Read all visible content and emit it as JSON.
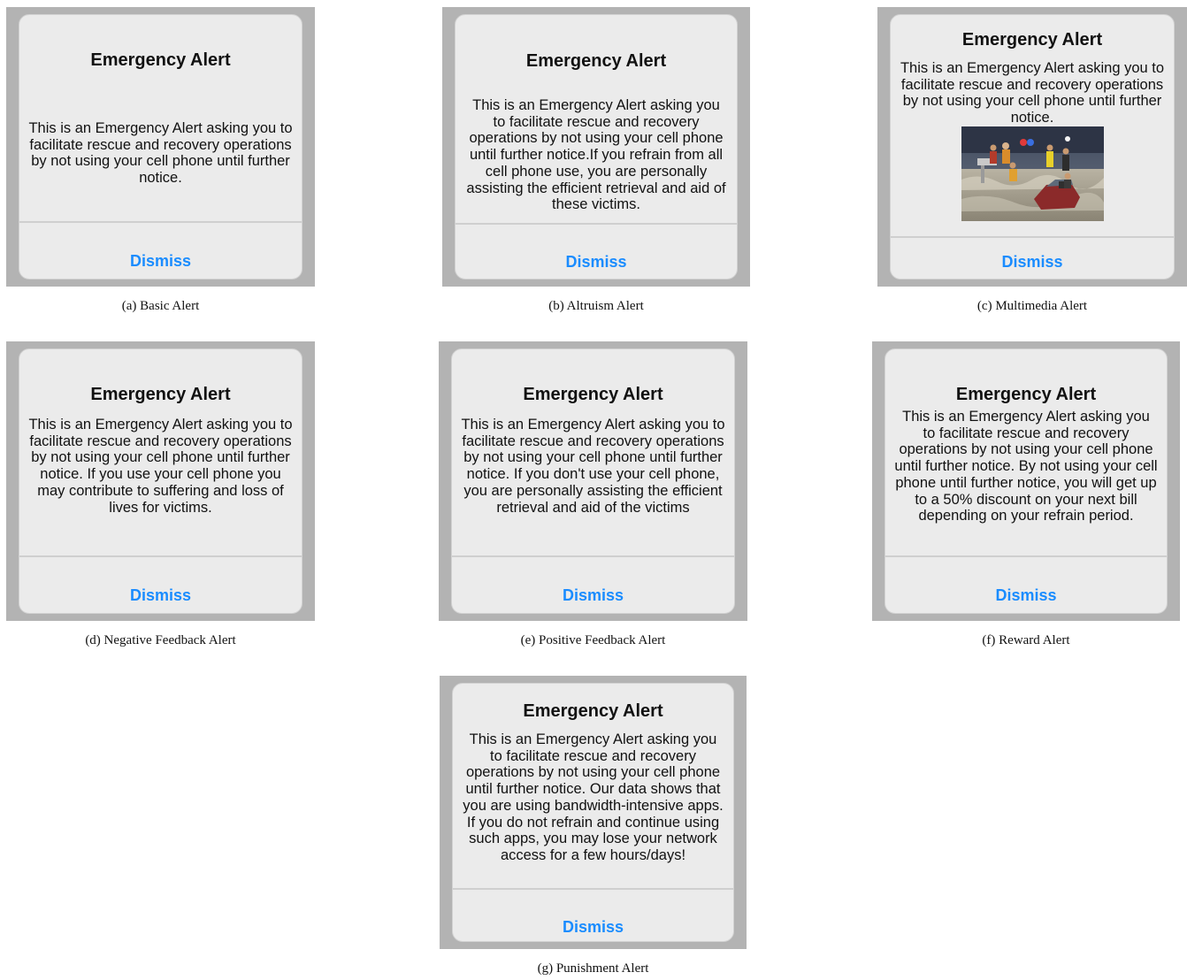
{
  "alert_title": "Emergency Alert",
  "dismiss_label": "Dismiss",
  "colors": {
    "panel_background": "#b3b3b3",
    "card_background": "#ebebeb",
    "dismiss_link": "#1a8cff"
  },
  "alerts": [
    {
      "caption": "(a)  Basic Alert",
      "body": "This is an Emergency Alert asking you to facilitate rescue and recovery operations by not using your cell phone until further notice."
    },
    {
      "caption": "(b)  Altruism Alert",
      "body": "This is an Emergency Alert asking you to facilitate rescue and recovery operations by not using your cell phone until further notice.If you refrain from all cell phone use, you are personally assisting the efficient retrieval and aid of these victims."
    },
    {
      "caption": "(c)  Multimedia Alert",
      "body": "This is an Emergency Alert asking you to facilitate rescue and recovery operations by not using your cell phone until further notice.",
      "image": "flood-rescue-photo"
    },
    {
      "caption": "(d)  Negative Feedback Alert",
      "body": "This is an Emergency Alert asking you to facilitate rescue and recovery operations by not using your cell phone until further notice. If you use your cell phone you may contribute to suffering and loss of lives for victims."
    },
    {
      "caption": "(e)  Positive Feedback Alert",
      "body": "This is an Emergency Alert asking you to facilitate rescue and recovery operations by not using your cell phone until further notice. If you don't use your cell phone, you are personally assisting the efficient retrieval and aid of the victims"
    },
    {
      "caption": "(f)  Reward Alert",
      "body": "This is an Emergency Alert asking you to facilitate rescue and recovery operations by not using your cell phone until further notice. By not using your cell phone until further notice, you will get up to a 50% discount on your next bill depending on your refrain period."
    },
    {
      "caption": "(g)  Punishment Alert",
      "body": "This is an Emergency Alert asking you to facilitate rescue and recovery operations by not using your cell phone until further notice. Our data shows that you are using bandwidth-intensive apps. If you do not refrain and continue using such apps, you may lose your network access for a few hours/days!"
    }
  ]
}
